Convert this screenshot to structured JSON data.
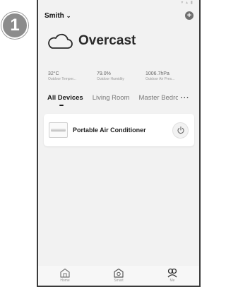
{
  "step_number": "1",
  "status_bar": {
    "indicators": "▾ ▴ ▮"
  },
  "header": {
    "home_name": "Smith",
    "chevron": "⌄",
    "add_glyph": "+"
  },
  "weather": {
    "title": "Overcast",
    "icon": "cloud-icon",
    "stats": [
      {
        "value": "32°C",
        "label": "Outdoor Temper..."
      },
      {
        "value": "79.0%",
        "label": "Outdoor Humidity"
      },
      {
        "value": "1006.7hPa",
        "label": "Outdoor Air Pres..."
      }
    ]
  },
  "tabs": {
    "items": [
      "All Devices",
      "Living Room",
      "Master Bedroom"
    ],
    "more": "···"
  },
  "devices": [
    {
      "name": "Portable Air Conditioner",
      "icon": "air-conditioner-icon",
      "power_icon": "power-icon"
    }
  ],
  "bottom_nav": [
    {
      "label": "Home",
      "icon": "home-icon"
    },
    {
      "label": "Smart",
      "icon": "smart-icon"
    },
    {
      "label": "Me",
      "icon": "me-icon"
    }
  ],
  "colors": {
    "badge": "#8c8c8c",
    "background": "#f2f2f2",
    "card": "#ffffff",
    "text_dark": "#1b1b1b"
  }
}
